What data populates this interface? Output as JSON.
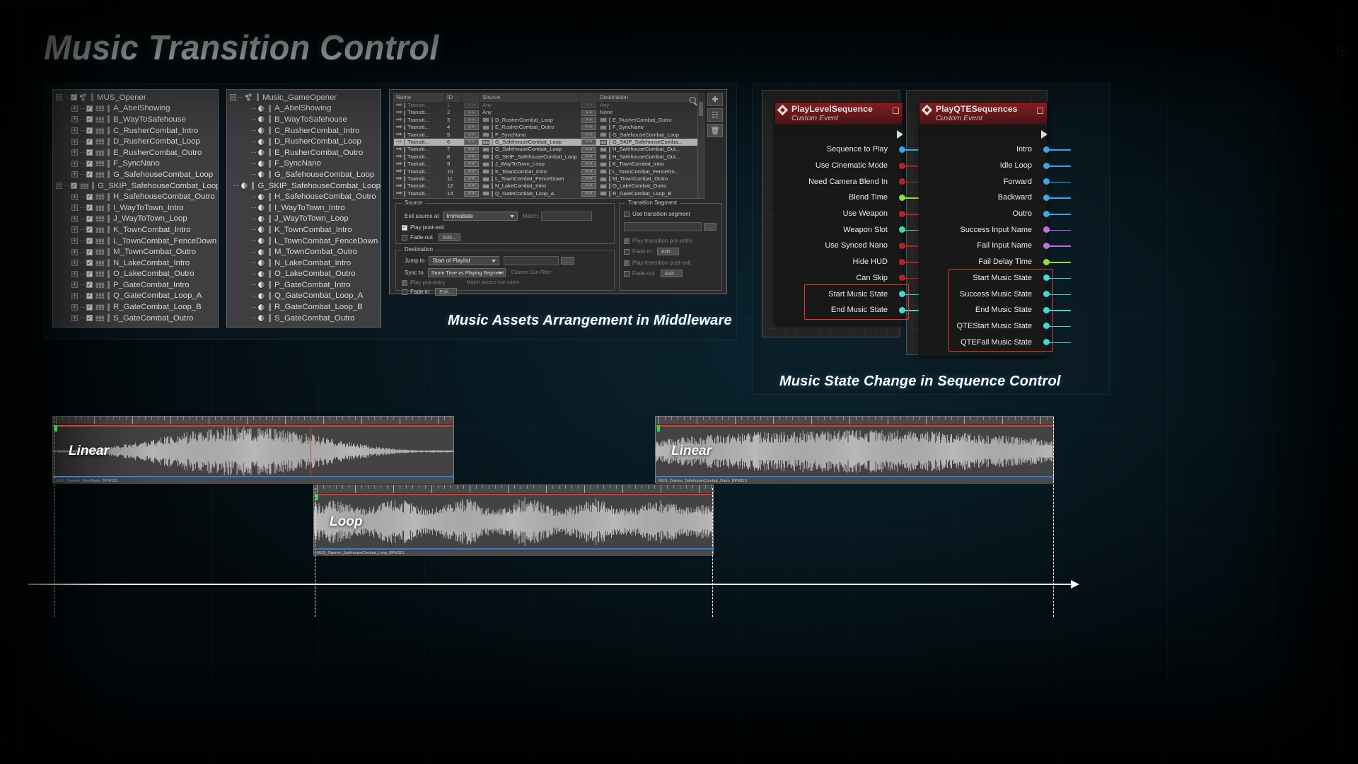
{
  "page": {
    "title": "Music Transition Control"
  },
  "captions": {
    "middleware": "Music Assets Arrangement in Middleware",
    "sequence": "Music State Change in Sequence Control"
  },
  "tree_panel_a": {
    "root": "MUS_Opener",
    "items": [
      "A_AbelShowing",
      "B_WayToSafehouse",
      "C_RusherCombat_Intro",
      "D_RusherCombat_Loop",
      "E_RusherCombat_Outro",
      "F_SyncNano",
      "G_SafehouseCombat_Loop",
      "G_SKIP_SafehouseCombat_Loop",
      "H_SafehouseCombat_Outro",
      "I_WayToTown_Intro",
      "J_WayToTown_Loop",
      "K_TownCombat_Intro",
      "L_TownCombat_FenceDown",
      "M_TownCombat_Outro",
      "N_LakeCombat_Intro",
      "O_LakeCombat_Outro",
      "P_GateCombat_Intro",
      "Q_GateCombat_Loop_A",
      "R_GateCombat_Loop_B",
      "S_GateCombat_Outro"
    ]
  },
  "tree_panel_b": {
    "root": "Music_GameOpener",
    "items": [
      "A_AbelShowing",
      "B_WayToSafehouse",
      "C_RusherCombat_Intro",
      "D_RusherCombat_Loop",
      "E_RusherCombat_Outro",
      "F_SyncNano",
      "G_SafehouseCombat_Loop",
      "G_SKIP_SafehouseCombat_Loop",
      "H_SafehouseCombat_Outro",
      "I_WayToTown_Intro",
      "J_WayToTown_Loop",
      "K_TownCombat_Intro",
      "L_TownCombat_FenceDown",
      "M_TownCombat_Outro",
      "N_LakeCombat_Intro",
      "O_LakeCombat_Outro",
      "P_GateCombat_Intro",
      "Q_GateCombat_Loop_A",
      "R_GateCombat_Loop_B",
      "S_GateCombat_Outro"
    ]
  },
  "transition_editor": {
    "columns": [
      "Name",
      "ID",
      "",
      "Source",
      "",
      "Destination"
    ],
    "arrow_label": "> >",
    "selected_row_id": "6",
    "rows": [
      {
        "name": "Transiti...",
        "id": "1",
        "source": "Any",
        "destination": "Any",
        "src_icon": false,
        "dst_icon": false,
        "dim": true
      },
      {
        "name": "Transiti...",
        "id": "2",
        "source": "Any",
        "destination": "None",
        "src_icon": false,
        "dst_icon": false,
        "dim": false
      },
      {
        "name": "Transiti...",
        "id": "3",
        "source": "D_RusherCombat_Loop",
        "destination": "E_RusherCombat_Outro",
        "src_icon": true,
        "dst_icon": true,
        "dim": false
      },
      {
        "name": "Transiti...",
        "id": "4",
        "source": "E_RusherCombat_Outro",
        "destination": "F_SyncNano",
        "src_icon": true,
        "dst_icon": true,
        "dim": false
      },
      {
        "name": "Transiti...",
        "id": "5",
        "source": "F_SyncNano",
        "destination": "G_SafehouseCombat_Loop",
        "src_icon": true,
        "dst_icon": true,
        "dim": false
      },
      {
        "name": "Transiti...",
        "id": "6",
        "source": "G_SafehouseCombat_Loop",
        "destination": "G_SKIP_SafehouseComba...",
        "src_icon": true,
        "dst_icon": true,
        "dim": false
      },
      {
        "name": "Transiti...",
        "id": "7",
        "source": "G_SafehouseCombat_Loop",
        "destination": "H_SafehouseCombat_Out...",
        "src_icon": true,
        "dst_icon": true,
        "dim": false
      },
      {
        "name": "Transiti...",
        "id": "8",
        "source": "G_SKIP_SafehouseCombat_Loop",
        "destination": "H_SafehouseCombat_Out...",
        "src_icon": true,
        "dst_icon": true,
        "dim": false
      },
      {
        "name": "Transiti...",
        "id": "9",
        "source": "J_WayToTown_Loop",
        "destination": "K_TownCombat_Intro",
        "src_icon": true,
        "dst_icon": true,
        "dim": false
      },
      {
        "name": "Transiti...",
        "id": "10",
        "source": "K_TownCombat_Intro",
        "destination": "L_TownCombat_FenceDo...",
        "src_icon": true,
        "dst_icon": true,
        "dim": false
      },
      {
        "name": "Transiti...",
        "id": "11",
        "source": "L_TownCombat_FenceDown",
        "destination": "M_TownCombat_Outro",
        "src_icon": true,
        "dst_icon": true,
        "dim": false
      },
      {
        "name": "Transiti...",
        "id": "12",
        "source": "N_LakeCombat_Intro",
        "destination": "O_LakeCombat_Outro",
        "src_icon": true,
        "dst_icon": true,
        "dim": false
      },
      {
        "name": "Transiti...",
        "id": "13",
        "source": "Q_GateCombat_Loop_A",
        "destination": "R_GateCombat_Loop_B",
        "src_icon": true,
        "dst_icon": true,
        "dim": false
      }
    ],
    "source_group": {
      "title": "Source",
      "exit_label": "Exit source at",
      "exit_value": "Immediate",
      "match_label": "Match:",
      "match_value": "",
      "play_post_exit": "Play post-exit",
      "play_post_exit_checked": true,
      "fade_out": "Fade-out",
      "fade_out_checked": false,
      "edit_label": "Edit..."
    },
    "destination_group": {
      "title": "Destination",
      "jump_label": "Jump to",
      "jump_value": "Start of Playlist",
      "sync_label": "Sync to",
      "sync_value": "Same Time as Playing Segment",
      "play_pre_entry": "Play pre-entry",
      "play_pre_entry_checked": true,
      "fade_in": "Fade-in",
      "fade_in_checked": false,
      "edit_label": "Edit...",
      "custom_cue_filter": "Custom Cue Filter:",
      "match_source_cue": "Match source cue name",
      "match_label": "Match:"
    },
    "transition_segment_group": {
      "title": "Transition Segment",
      "use_transition_segment": "Use transition segment",
      "use_checked": false,
      "segment_value": "",
      "browse_label": "...",
      "play_pre_entry": "Play transition pre-entry",
      "play_pre_entry_checked": true,
      "fade_in": "Fade-in",
      "fade_in_checked": false,
      "play_post_exit": "Play transition post-exit",
      "play_post_exit_checked": true,
      "fade_out": "Fade-out",
      "fade_out_checked": false,
      "edit_label": "Edit..."
    }
  },
  "blueprint_nodes": [
    {
      "title": "PlayLevelSequence",
      "subtitle": "Custom Event",
      "pins": [
        {
          "label": "Sequence to Play",
          "color": "#3aa8e8"
        },
        {
          "label": "Use Cinematic Mode",
          "color": "#b52222"
        },
        {
          "label": "Need Camera Blend In",
          "color": "#b52222"
        },
        {
          "label": "Blend Time",
          "color": "#8ee03a"
        },
        {
          "label": "Use Weapon",
          "color": "#b52222"
        },
        {
          "label": "Weapon Slot",
          "color": "#4ad6a0"
        },
        {
          "label": "Use Synced Nano",
          "color": "#b52222"
        },
        {
          "label": "Hide HUD",
          "color": "#b52222"
        },
        {
          "label": "Can Skip",
          "color": "#b52222"
        },
        {
          "label": "Start Music State",
          "color": "#4ad6d0",
          "highlight": true
        },
        {
          "label": "End Music State",
          "color": "#4ad6d0",
          "highlight": true
        }
      ]
    },
    {
      "title": "PlayQTESequences",
      "subtitle": "Custom Event",
      "pins": [
        {
          "label": "Intro",
          "color": "#3aa8e8"
        },
        {
          "label": "Idle Loop",
          "color": "#3aa8e8"
        },
        {
          "label": "Forward",
          "color": "#3aa8e8"
        },
        {
          "label": "Backward",
          "color": "#3aa8e8"
        },
        {
          "label": "Outro",
          "color": "#3aa8e8"
        },
        {
          "label": "Success Input Name",
          "color": "#c06fe0"
        },
        {
          "label": "Fail Input Name",
          "color": "#c06fe0"
        },
        {
          "label": "Fail Delay Time",
          "color": "#8ee03a"
        },
        {
          "label": "Start Music State",
          "color": "#4ad6d0",
          "highlight": true
        },
        {
          "label": "Success Music State",
          "color": "#4ad6d0",
          "highlight": true
        },
        {
          "label": "End Music State",
          "color": "#4ad6d0",
          "highlight": true
        },
        {
          "label": "QTEStart Music State",
          "color": "#4ad6d0",
          "highlight": true
        },
        {
          "label": "QTEFail Music State",
          "color": "#4ad6d0",
          "highlight": true
        }
      ]
    }
  ],
  "waveforms": [
    {
      "id": "wave-linear-1",
      "label": "Linear",
      "filename": "MUS_Opener_SyncNano_BPM115"
    },
    {
      "id": "wave-linear-2",
      "label": "Linear",
      "filename": "MUS_Opener_SafehouseCombat_Outro_BPM115"
    },
    {
      "id": "wave-loop",
      "label": "Loop",
      "filename": "MUS_Opener_SafehouseCombat_Loop_BPM115"
    }
  ],
  "colors": {
    "accent_red": "#e23a2e",
    "accent_green": "#2fd44a",
    "accent_blue": "#3b7fd4",
    "music_pin": "#4ad6d0",
    "node_header": "#8d1f1f"
  }
}
